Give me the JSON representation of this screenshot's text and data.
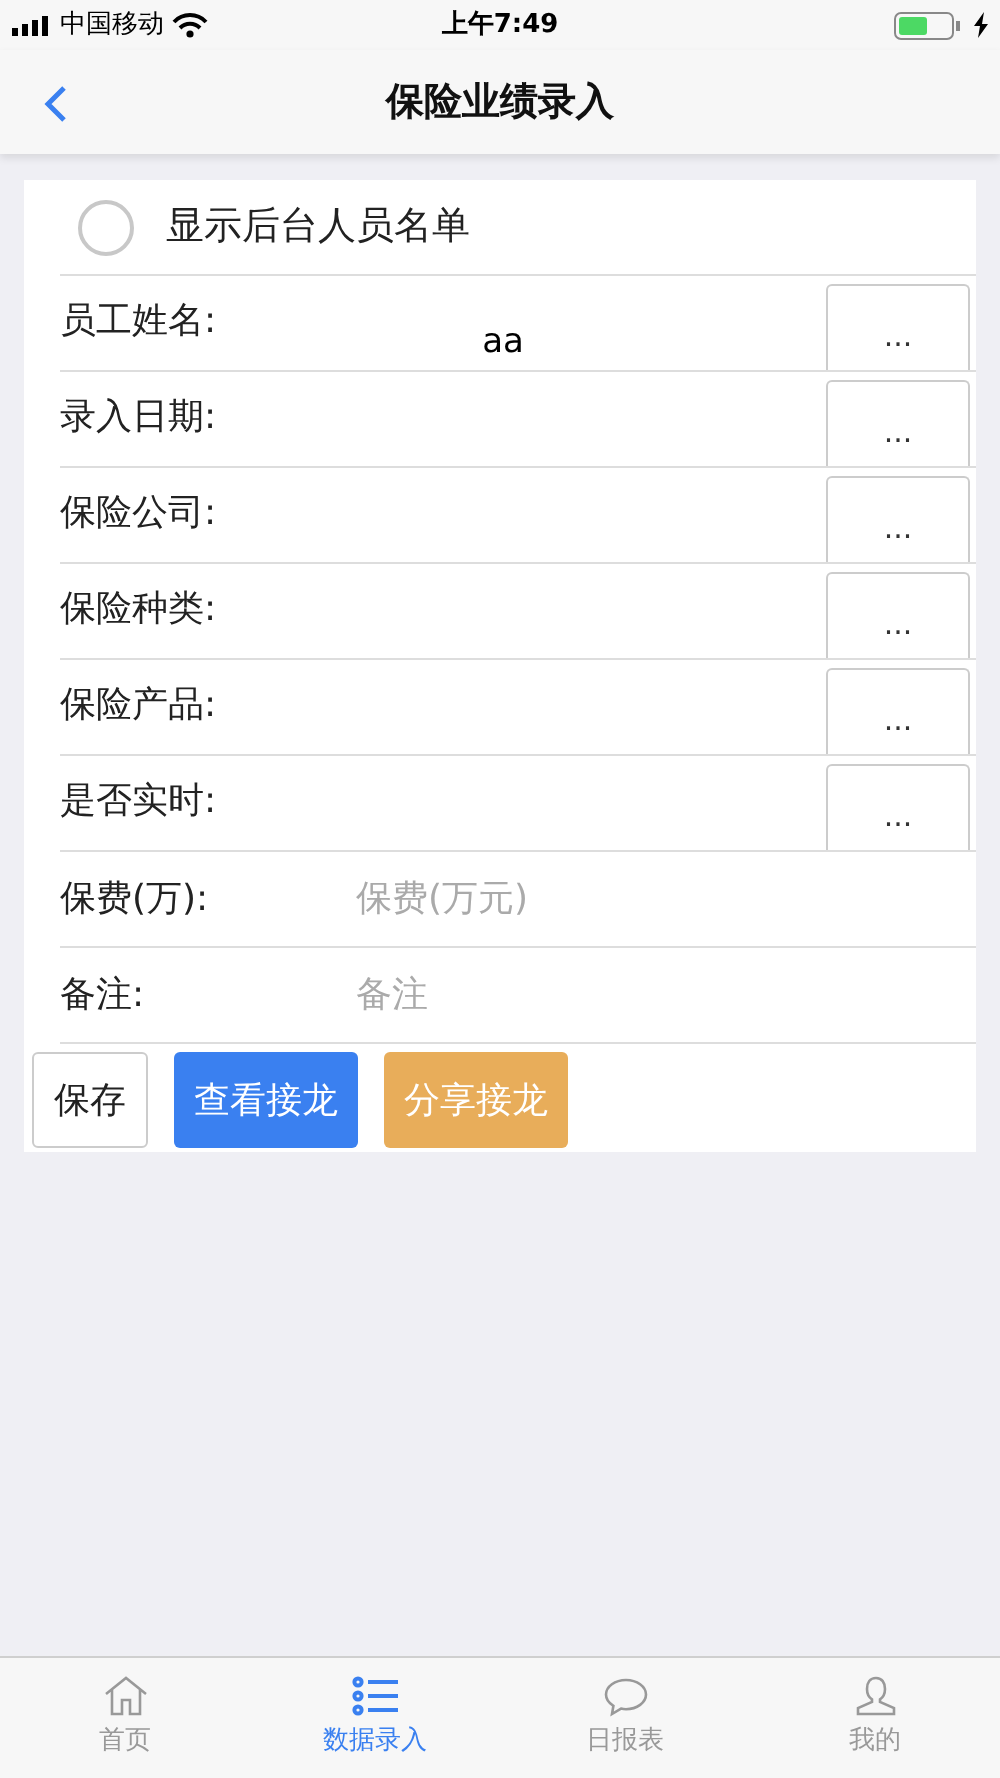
{
  "status_bar": {
    "carrier": "中国移动",
    "time": "上午7:49"
  },
  "nav": {
    "title": "保险业绩录入"
  },
  "toggle": {
    "label": "显示后台人员名单",
    "checked": false
  },
  "picker_fields": [
    {
      "label": "员工姓名:",
      "value": "aa",
      "button": "..."
    },
    {
      "label": "录入日期:",
      "button": "..."
    },
    {
      "label": "保险公司:",
      "button": "..."
    },
    {
      "label": "保险种类:",
      "button": "..."
    },
    {
      "label": "保险产品:",
      "button": "..."
    },
    {
      "label": "是否实时:",
      "button": "..."
    }
  ],
  "input_fields": [
    {
      "label": "保费(万):",
      "placeholder": "保费(万元)"
    },
    {
      "label": "备注:",
      "placeholder": "备注"
    }
  ],
  "buttons": [
    {
      "label": "保存",
      "kind": "outline"
    },
    {
      "label": "查看接龙",
      "kind": "primary"
    },
    {
      "label": "分享接龙",
      "kind": "warning"
    }
  ],
  "tab_bar": [
    {
      "label": "首页",
      "selected": false
    },
    {
      "label": "数据录入",
      "selected": true
    },
    {
      "label": "日报表",
      "selected": false
    },
    {
      "label": "我的",
      "selected": false
    }
  ]
}
